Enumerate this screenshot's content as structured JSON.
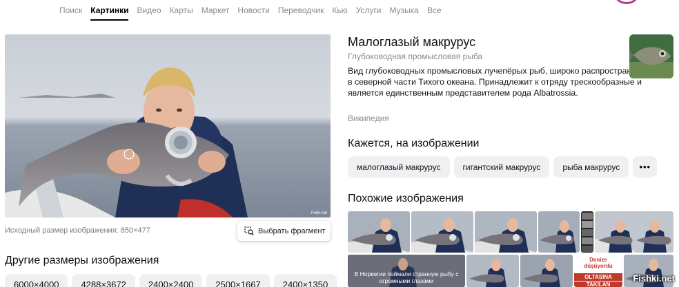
{
  "nav": {
    "items": [
      {
        "label": "Поиск"
      },
      {
        "label": "Картинки",
        "active": true
      },
      {
        "label": "Видео"
      },
      {
        "label": "Карты"
      },
      {
        "label": "Маркет"
      },
      {
        "label": "Новости"
      },
      {
        "label": "Переводчик"
      },
      {
        "label": "Кью"
      },
      {
        "label": "Услуги"
      },
      {
        "label": "Музыка"
      },
      {
        "label": "Все"
      }
    ]
  },
  "image": {
    "source_size_text": "Исходный размер изображения: 850×477",
    "fragment_button": "Выбрать фрагмент",
    "image_credit": "Fotki.net"
  },
  "other_sizes": {
    "title": "Другие размеры изображения",
    "sizes": [
      "6000×4000",
      "4288×3672",
      "2400×2400",
      "2500×1667",
      "2400×1350"
    ]
  },
  "entity": {
    "title": "Малоглазый макрурус",
    "subtitle": "Глубоководная промысловая рыба",
    "description": "Вид глубоководных промысловых лучепёрых рыб, широко распространённых в северной части Тихого океана. Принадлежит к отряду трескообразные и является единственным представителем рода Albatrossia.",
    "source": "Википедия"
  },
  "seems": {
    "title": "Кажется, на изображении",
    "tags": [
      "малоглазый макрурус",
      "гигантский макрурус",
      "рыба макрурус"
    ],
    "more_icon": "more-dots-icon"
  },
  "similar": {
    "title": "Похожие изображения",
    "caption_1": "В Норвегии поймали странную рыбу с огромными глазами",
    "red_line_1": "Denize",
    "red_line_2": "düşüyordu",
    "red_line_3": "OLTASINA",
    "red_line_4": "TAKILAN"
  },
  "watermark": "Fishki.net",
  "colors": {
    "accent_active": "#000000",
    "chip_bg": "#f0f0f3",
    "muted_text": "#8a8a8a"
  }
}
